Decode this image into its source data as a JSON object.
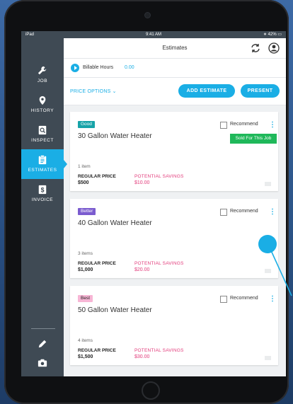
{
  "status_bar": {
    "carrier": "iPad",
    "time": "9:41 AM",
    "battery": "42%"
  },
  "header": {
    "title": "Estimates"
  },
  "sidebar": {
    "items": [
      {
        "label": "JOB",
        "icon": "wrench-icon"
      },
      {
        "label": "HISTORY",
        "icon": "map-pin-icon"
      },
      {
        "label": "INSPECT",
        "icon": "magnifier-document-icon"
      },
      {
        "label": "ESTIMATES",
        "icon": "clipboard-icon"
      },
      {
        "label": "INVOICE",
        "icon": "dollar-document-icon"
      }
    ],
    "active": "ESTIMATES",
    "bottom_icons": [
      "pencil-icon",
      "camera-icon"
    ]
  },
  "billable": {
    "label": "Billable Hours",
    "value": "0.00"
  },
  "toolbar": {
    "price_options_label": "PRICE OPTIONS",
    "add_estimate_label": "ADD ESTIMATE",
    "present_label": "PRESENT"
  },
  "cards": [
    {
      "tier": "Good",
      "name": "30 Gallon Water Heater",
      "recommend_label": "Recommend",
      "sold_label": "Sold For This Job",
      "items": "1 item",
      "regular_price_label": "REGULAR PRICE",
      "regular_price": "$500",
      "savings_label": "POTENTIAL SAVINGS",
      "savings": "$10.00"
    },
    {
      "tier": "Better",
      "name": "40 Gallon Water Heater",
      "recommend_label": "Recommend",
      "items": "3 items",
      "regular_price_label": "REGULAR PRICE",
      "regular_price": "$1,000",
      "savings_label": "POTENTIAL SAVINGS",
      "savings": "$20.00"
    },
    {
      "tier": "Best",
      "name": "50 Gallon Water Heater",
      "recommend_label": "Recommend",
      "items": "4 items",
      "regular_price_label": "REGULAR PRICE",
      "regular_price": "$1,500",
      "savings_label": "POTENTIAL SAVINGS",
      "savings": "$30.00"
    }
  ],
  "colors": {
    "accent": "#1aaee5",
    "sidebar": "#3f4a54",
    "good_tag": "#17a3a8",
    "better_tag": "#7b5ccf",
    "best_tag": "#f7b6d5",
    "savings": "#e23a7a",
    "sold": "#1fb85a"
  }
}
